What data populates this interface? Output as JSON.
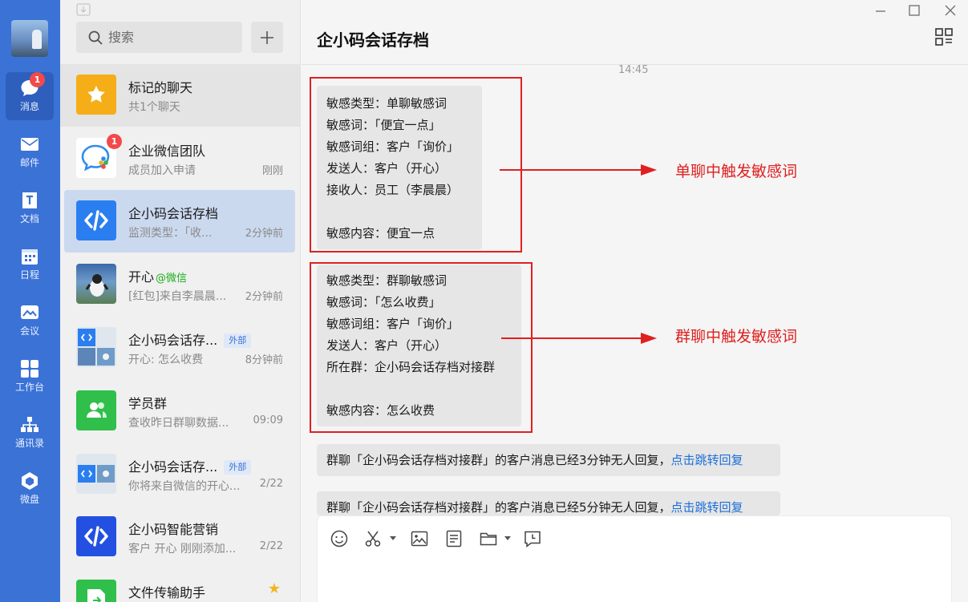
{
  "nav": {
    "items": [
      {
        "label": "消息",
        "icon": "chat-icon",
        "badge": "1",
        "active": true
      },
      {
        "label": "邮件",
        "icon": "mail-icon"
      },
      {
        "label": "文档",
        "icon": "document-icon"
      },
      {
        "label": "日程",
        "icon": "calendar-icon"
      },
      {
        "label": "会议",
        "icon": "meeting-icon"
      },
      {
        "label": "工作台",
        "icon": "workbench-icon"
      },
      {
        "label": "通讯录",
        "icon": "contacts-icon"
      },
      {
        "label": "微盘",
        "icon": "drive-icon"
      }
    ]
  },
  "search": {
    "placeholder": "搜索"
  },
  "chats": [
    {
      "name": "标记的聊天",
      "sub": "共1个聊天",
      "time": ""
    },
    {
      "name": "企业微信团队",
      "sub": "成员加入申请",
      "time": "刚刚",
      "badge": "1"
    },
    {
      "name": "企小码会话存档",
      "sub": "监测类型：「收...",
      "time": "2分钟前"
    },
    {
      "name": "开心",
      "wx_tag": "@微信",
      "sub": "[红包]来自李晨晨...",
      "time": "2分钟前"
    },
    {
      "name": "企小码会话存...",
      "tag": "外部",
      "sub": "开心: 怎么收费",
      "time": "8分钟前"
    },
    {
      "name": "学员群",
      "sub": "查收昨日群聊数据...",
      "time": "09:09"
    },
    {
      "name": "企小码会话存...",
      "tag": "外部",
      "sub": "你将来自微信的开心...",
      "time": "2/22"
    },
    {
      "name": "企小码智能营销",
      "sub": "客户 开心 刚刚添加...",
      "time": "2/22"
    },
    {
      "name": "文件传输助手",
      "sub": "",
      "time": ""
    }
  ],
  "conversation": {
    "title": "企小码会话存档",
    "timestamp": "14:45",
    "messages": [
      {
        "lines": [
          "敏感类型：单聊敏感词",
          "敏感词：「便宜一点」",
          "敏感词组：客户「询价」",
          "发送人：客户（开心）",
          "接收人：员工（李晨晨）",
          "",
          "敏感内容：便宜一点"
        ],
        "annotation": "单聊中触发敏感词"
      },
      {
        "lines": [
          "敏感类型：群聊敏感词",
          "敏感词：「怎么收费」",
          "敏感词组：客户「询价」",
          "发送人：客户（开心）",
          "所在群：企小码会话存档对接群",
          "",
          "敏感内容：怎么收费"
        ],
        "annotation": "群聊中触发敏感词"
      }
    ],
    "notices": [
      {
        "text": "群聊「企小码会话存档对接群」的客户消息已经3分钟无人回复，",
        "link": "点击跳转回复"
      },
      {
        "text": "群聊「企小码会话存档对接群」的客户消息已经5分钟无人回复，",
        "link": "点击跳转回复"
      }
    ]
  },
  "colors": {
    "nav": "#3a72d6",
    "annotation": "#e02020",
    "link": "#1e6fd8"
  }
}
